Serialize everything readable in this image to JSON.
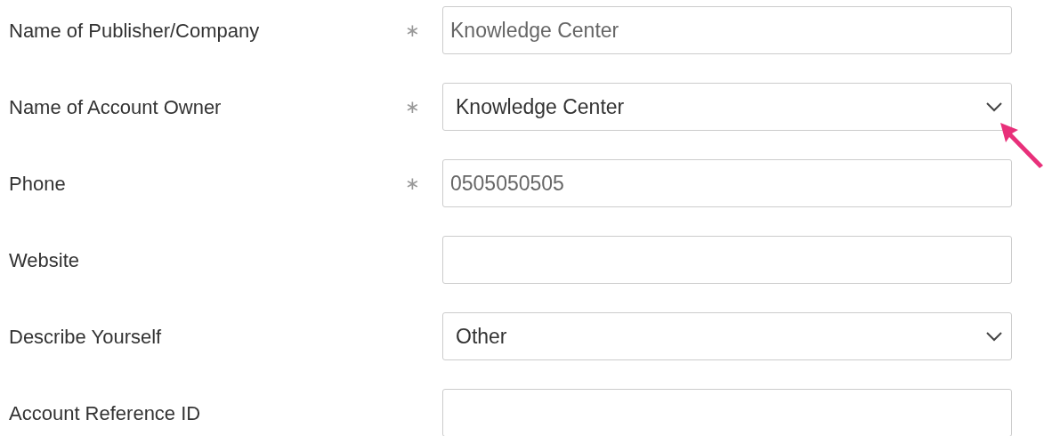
{
  "fields": [
    {
      "label": "Name of Publisher/Company",
      "marker": "∗",
      "kind": "text",
      "value": "Knowledge Center"
    },
    {
      "label": "Name of Account Owner",
      "marker": "∗",
      "kind": "select",
      "value": "Knowledge Center"
    },
    {
      "label": "Phone",
      "marker": "∗",
      "kind": "text",
      "value": "0505050505"
    },
    {
      "label": "Website",
      "kind": "text"
    },
    {
      "label": "Describe Yourself",
      "kind": "select",
      "value": "Other"
    },
    {
      "label": "Account Reference ID",
      "kind": "text"
    }
  ]
}
